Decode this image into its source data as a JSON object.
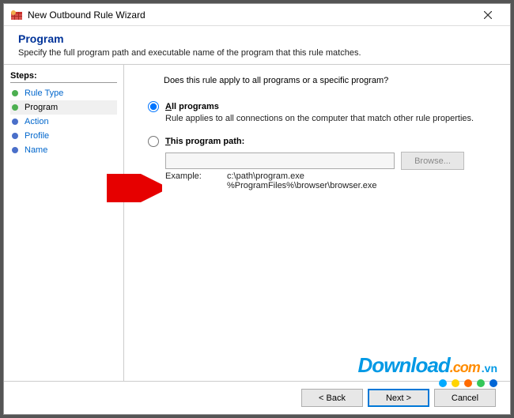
{
  "window": {
    "title": "New Outbound Rule Wizard"
  },
  "header": {
    "title": "Program",
    "description": "Specify the full program path and executable name of the program that this rule matches."
  },
  "sidebar": {
    "steps_label": "Steps:",
    "items": [
      {
        "label": "Rule Type",
        "state": "done"
      },
      {
        "label": "Program",
        "state": "current"
      },
      {
        "label": "Action",
        "state": "pending"
      },
      {
        "label": "Profile",
        "state": "pending"
      },
      {
        "label": "Name",
        "state": "pending"
      }
    ]
  },
  "content": {
    "question": "Does this rule apply to all programs or a specific program?",
    "option_all": {
      "mnemonic": "A",
      "label_rest": "ll programs",
      "description": "Rule applies to all connections on the computer that match other rule properties.",
      "selected": true
    },
    "option_path": {
      "mnemonic": "T",
      "label_rest": "his program path:",
      "selected": false,
      "input_value": "",
      "browse_label": "Browse...",
      "example_label": "Example:",
      "example_paths": "c:\\path\\program.exe\n%ProgramFiles%\\browser\\browser.exe"
    }
  },
  "footer": {
    "back": "< Back",
    "next": "Next >",
    "cancel": "Cancel"
  },
  "watermark": {
    "part1": "Download",
    "part2": ".com",
    "part3": ".vn",
    "dot_colors": [
      "#00aaff",
      "#ffd400",
      "#ff6a00",
      "#34c759",
      "#0066d6"
    ]
  }
}
